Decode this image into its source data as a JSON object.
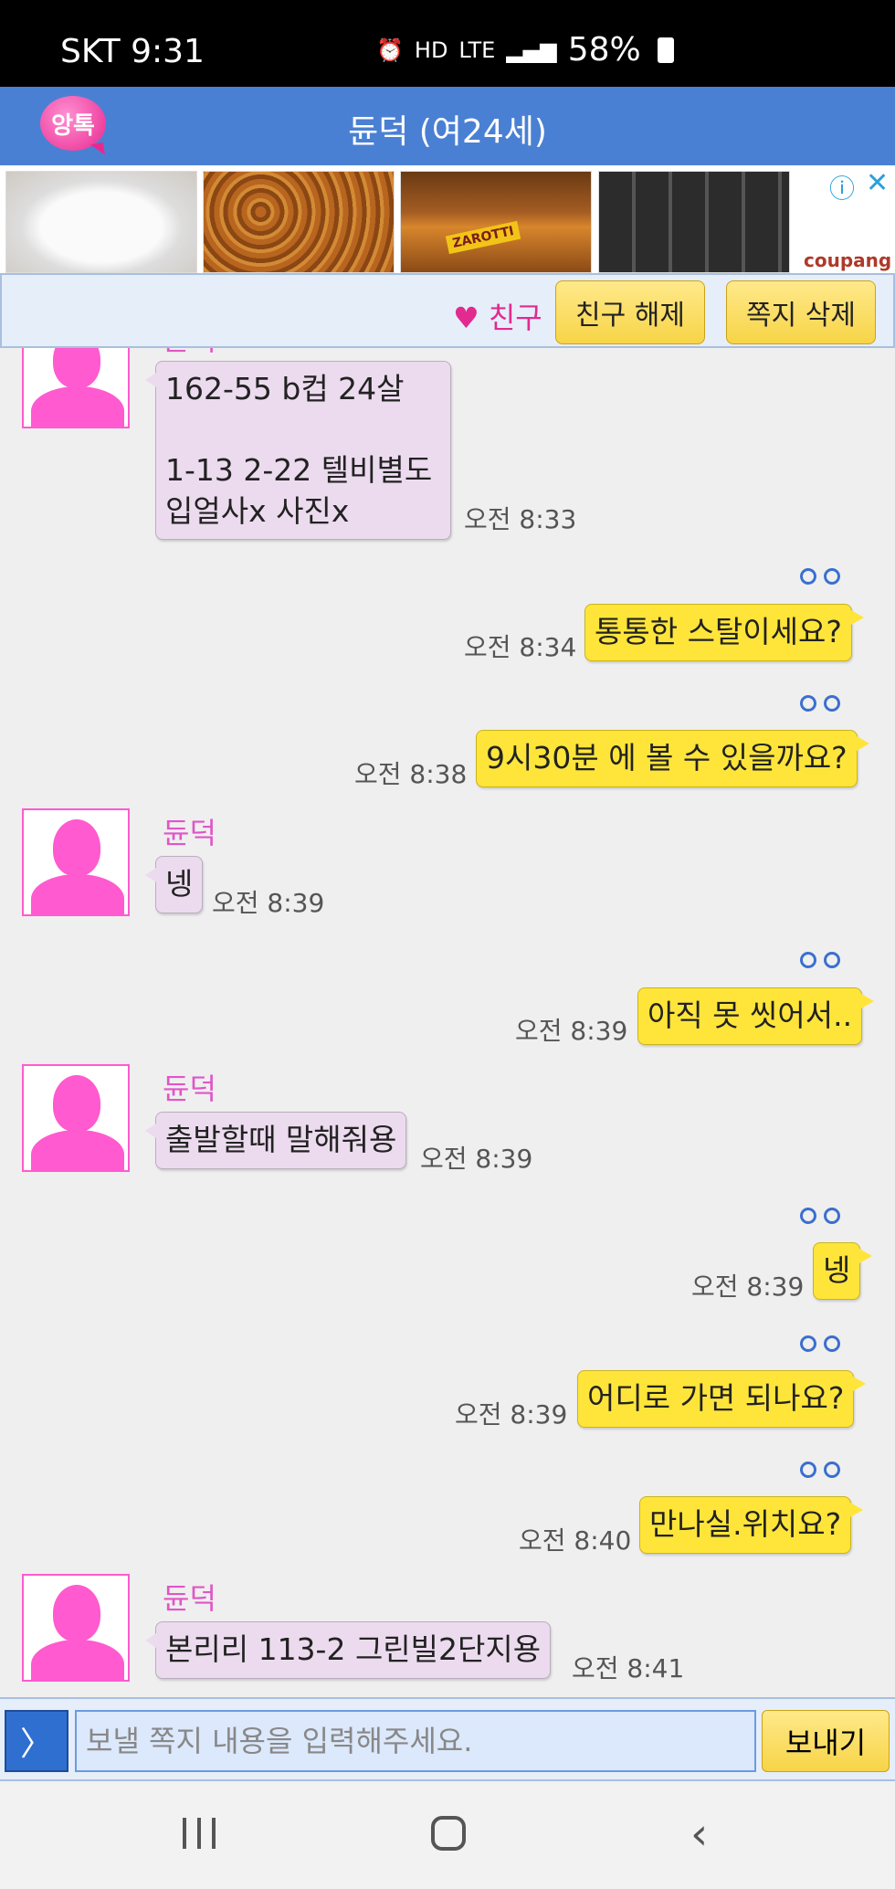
{
  "status_bar": {
    "carrier_time": "SKT 9:31",
    "icons": [
      "alarm-icon",
      "hd-voice-icon",
      "lte-icon",
      "signal-icon"
    ],
    "hd": "HD",
    "lte": "LTE",
    "battery": "58%"
  },
  "header": {
    "logo_text": "앙톡",
    "title": "듄덕 (여24세)",
    "color": "#4a80d3"
  },
  "ads": {
    "info_icon": "ⓘ",
    "close_icon": "✕",
    "brand": "coupang",
    "item3_label": "ZAROTTI"
  },
  "actions": {
    "friend_label": "♥ 친구",
    "unfriend": "친구 해제",
    "delete": "쪽지 삭제"
  },
  "messages": [
    {
      "side": "in",
      "sender": "듄덕",
      "text": "162-55 b컵 24살\n\n1-13 2-22 텔비별도\n입얼사x 사진x",
      "time": "오전 8:33"
    },
    {
      "side": "out",
      "read": "○○",
      "text": "통통한 스탈이세요?",
      "time": "오전 8:34"
    },
    {
      "side": "out",
      "read": "○○",
      "text": "9시30분 에 볼 수 있을까요?",
      "time": "오전 8:38"
    },
    {
      "side": "in",
      "sender": "듄덕",
      "text": "넹",
      "time": "오전 8:39"
    },
    {
      "side": "out",
      "read": "○○",
      "text": "아직 못 씻어서..",
      "time": "오전 8:39"
    },
    {
      "side": "in",
      "sender": "듄덕",
      "text": "출발할때 말해줘용",
      "time": "오전 8:39"
    },
    {
      "side": "out",
      "read": "○○",
      "text": "넹",
      "time": "오전 8:39"
    },
    {
      "side": "out",
      "read": "○○",
      "text": "어디로 가면 되나요?",
      "time": "오전 8:39"
    },
    {
      "side": "out",
      "read": "○○",
      "text": "만나실.위치요?",
      "time": "오전 8:40"
    },
    {
      "side": "in",
      "sender": "듄덕",
      "text": "본리리 113-2 그린빌2단지용",
      "time": "오전 8:41"
    }
  ],
  "input": {
    "expand": "〉",
    "placeholder": "보낼 쪽지 내용을 입력해주세요.",
    "send": "보내기"
  },
  "nav": {
    "icons": [
      "recent-apps-icon",
      "home-icon",
      "back-icon"
    ],
    "back": "‹"
  }
}
